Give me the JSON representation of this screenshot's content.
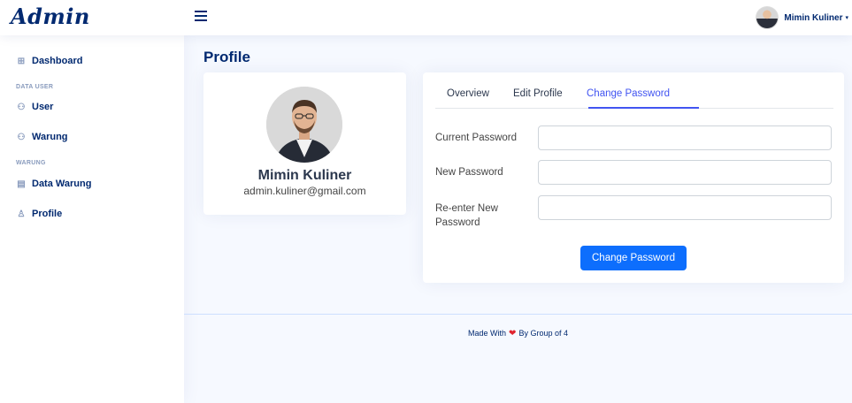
{
  "header": {
    "logo_text": "Admin",
    "user_name": "Mimin Kuliner",
    "user_caret": "▾"
  },
  "sidebar": {
    "items": [
      {
        "label": "Dashboard",
        "icon": "grid-icon",
        "glyph": "⊞"
      },
      {
        "label": "User",
        "icon": "people-icon",
        "glyph": "⚇"
      },
      {
        "label": "Warung",
        "icon": "people-icon",
        "glyph": "⚇"
      },
      {
        "label": "Data Warung",
        "icon": "bank-icon",
        "glyph": "▤"
      },
      {
        "label": "Profile",
        "icon": "person-icon",
        "glyph": "♙"
      }
    ],
    "headings": [
      "DATA USER",
      "WARUNG"
    ]
  },
  "page": {
    "title": "Profile"
  },
  "profile": {
    "name": "Mimin Kuliner",
    "email": "admin.kuliner@gmail.com"
  },
  "tabs": [
    {
      "label": "Overview",
      "active": false
    },
    {
      "label": "Edit Profile",
      "active": false
    },
    {
      "label": "Change Password",
      "active": true
    }
  ],
  "form": {
    "current_password_label": "Current Password",
    "new_password_label": "New Password",
    "reenter_label_line1": "Re-enter New",
    "reenter_label_line2": "Password",
    "submit_label": "Change Password"
  },
  "footer": {
    "made_with": "Made With",
    "by": "By Group of 4"
  },
  "colors": {
    "primary_text": "#012970",
    "accent": "#4154f1",
    "button": "#0d6efd",
    "heart": "#e0242f",
    "background": "#f6f9ff"
  }
}
